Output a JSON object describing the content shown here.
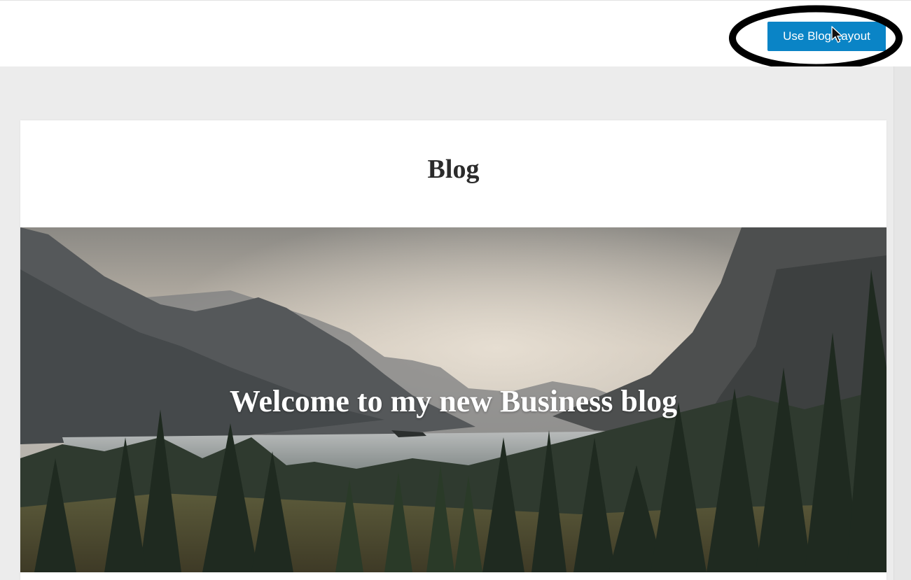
{
  "toolbar": {
    "use_blog_layout_label": "Use Blog Layout"
  },
  "page": {
    "title": "Blog",
    "hero": {
      "heading": "Welcome to my new Business blog",
      "image": "mountain-lake-forest-photo"
    }
  },
  "annotation": {
    "highlight_color": "#000000",
    "shape": "ellipse"
  },
  "colors": {
    "button": "#0a84c6",
    "canvas": "#ececec"
  }
}
